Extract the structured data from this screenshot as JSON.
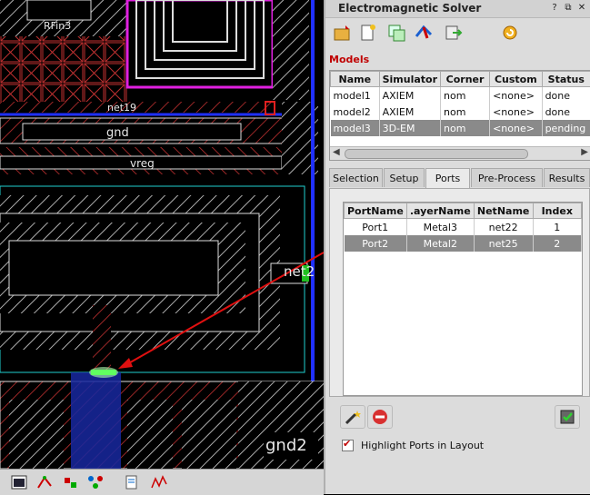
{
  "layout": {
    "net_labels": [
      "net19",
      "gnd",
      "vreg",
      "net2",
      "gnd2",
      "RFin3"
    ],
    "toolbar_icons": [
      "layout-view-icon",
      "route-icon",
      "component-icon",
      "network-icon",
      "document-icon",
      "graph-icon"
    ]
  },
  "panel": {
    "title": "Electromagnetic Solver",
    "window_buttons": [
      "?",
      "⧉",
      "✕"
    ],
    "toolbar_icons": [
      "new-model-icon",
      "document-new-icon",
      "copy-icon",
      "simulate-icon",
      "export-icon",
      "refresh-icon"
    ],
    "models_label": "Models",
    "models_table": {
      "columns": [
        "Name",
        "Simulator",
        "Corner",
        "Custom",
        "Status"
      ],
      "rows": [
        {
          "name": "model1",
          "simulator": "AXIEM",
          "corner": "nom",
          "custom": "<none>",
          "status": "done",
          "selected": false
        },
        {
          "name": "model2",
          "simulator": "AXIEM",
          "corner": "nom",
          "custom": "<none>",
          "status": "done",
          "selected": false
        },
        {
          "name": "model3",
          "simulator": "3D-EM",
          "corner": "nom",
          "custom": "<none>",
          "status": "pending",
          "selected": true
        }
      ]
    },
    "tabs": [
      {
        "label": "Selection",
        "active": false
      },
      {
        "label": "Setup",
        "active": false
      },
      {
        "label": "Ports",
        "active": true
      },
      {
        "label": "Pre-Process",
        "active": false
      },
      {
        "label": "Results",
        "active": false
      }
    ],
    "ports_table": {
      "columns": [
        "PortName",
        ".ayerName",
        "NetName",
        "Index"
      ],
      "rows": [
        {
          "port": "Port1",
          "layer": "Metal3",
          "net": "net22",
          "index": "1",
          "selected": false
        },
        {
          "port": "Port2",
          "layer": "Metal2",
          "net": "net25",
          "index": "2",
          "selected": true
        }
      ]
    },
    "highlight_label": "Highlight Ports in Layout",
    "highlight_checked": true,
    "colors": {
      "accent": "#c00000",
      "selection": "#8a8a8a",
      "arrow": "#e01010"
    }
  }
}
